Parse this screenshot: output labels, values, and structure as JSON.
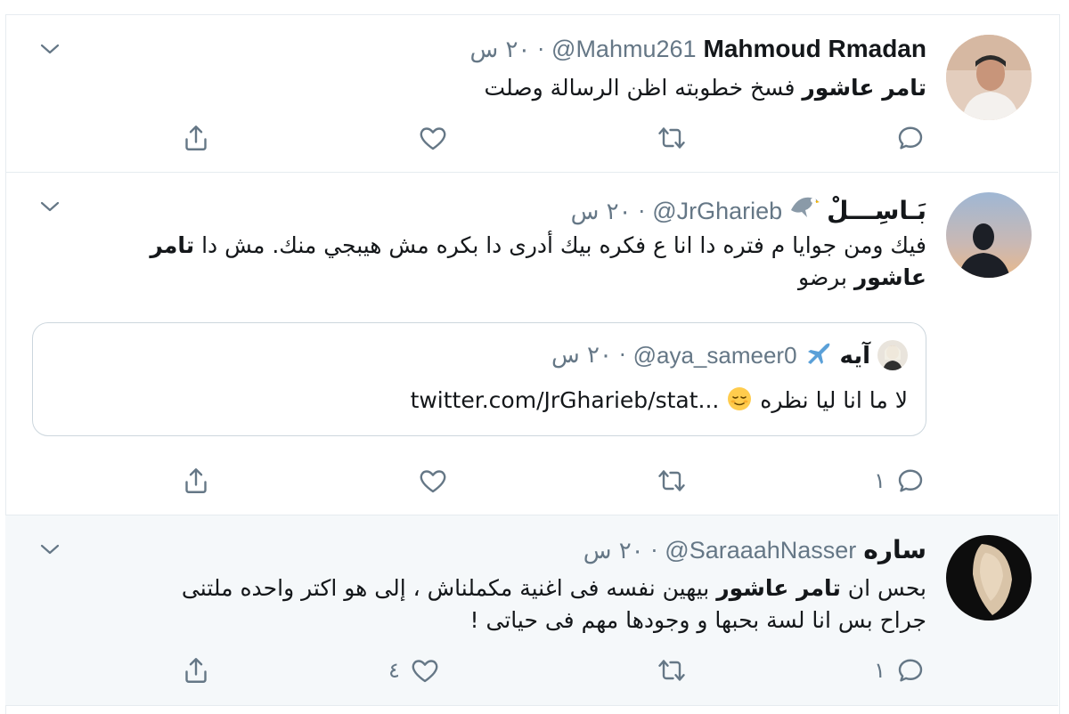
{
  "tweets": [
    {
      "name": "Mahmoud Rmadan",
      "handle": "@Mahmu261",
      "separator": "·",
      "time": "٢٠ س",
      "body_bold": "تامر عاشور",
      "body_rest": " فسخ خطوبته اظن الرسالة وصلت",
      "reply_count": "",
      "like_count": ""
    },
    {
      "name": "بَـاسِـــلْ",
      "name_emoji": "eagle-emoji",
      "handle": "@JrGharieb",
      "separator": "·",
      "time": "٢٠ س",
      "body_line1_rest": "فيك ومن جوايا م فتره دا انا ع فكره بيك أدرى دا بكره مش هيبجي منك. مش دا ",
      "body_line1_bold": "تامر",
      "body_line2_bold": "عاشور",
      "body_line2_rest": " برضو",
      "quote": {
        "name": "آيه",
        "name_emoji": "airplane-emoji",
        "handle": "@aya_sameer0",
        "separator": "·",
        "time": "٢٠ س",
        "text": "لا ما انا ليا نظره",
        "link": "twitter.com/JrGharieb/stat..."
      },
      "reply_count": "١",
      "like_count": ""
    },
    {
      "name": "ساره",
      "handle": "@SaraaahNasser",
      "separator": "·",
      "time": "٢٠ س",
      "body_line1_pre": "بحس ان ",
      "body_line1_bold": "تامر عاشور",
      "body_line1_rest": " بيهين نفسه فى اغنية مكملناش ، إلى هو اكتر واحده ملتنى",
      "body_line2": "جراح بس انا لسة بحبها و وجودها مهم فى حياتى !",
      "reply_count": "١",
      "like_count": "٤"
    }
  ],
  "colors": {
    "text": "#14171a",
    "muted": "#657786",
    "border": "#e6ecf0",
    "hover_bg": "#f5f8fa"
  }
}
